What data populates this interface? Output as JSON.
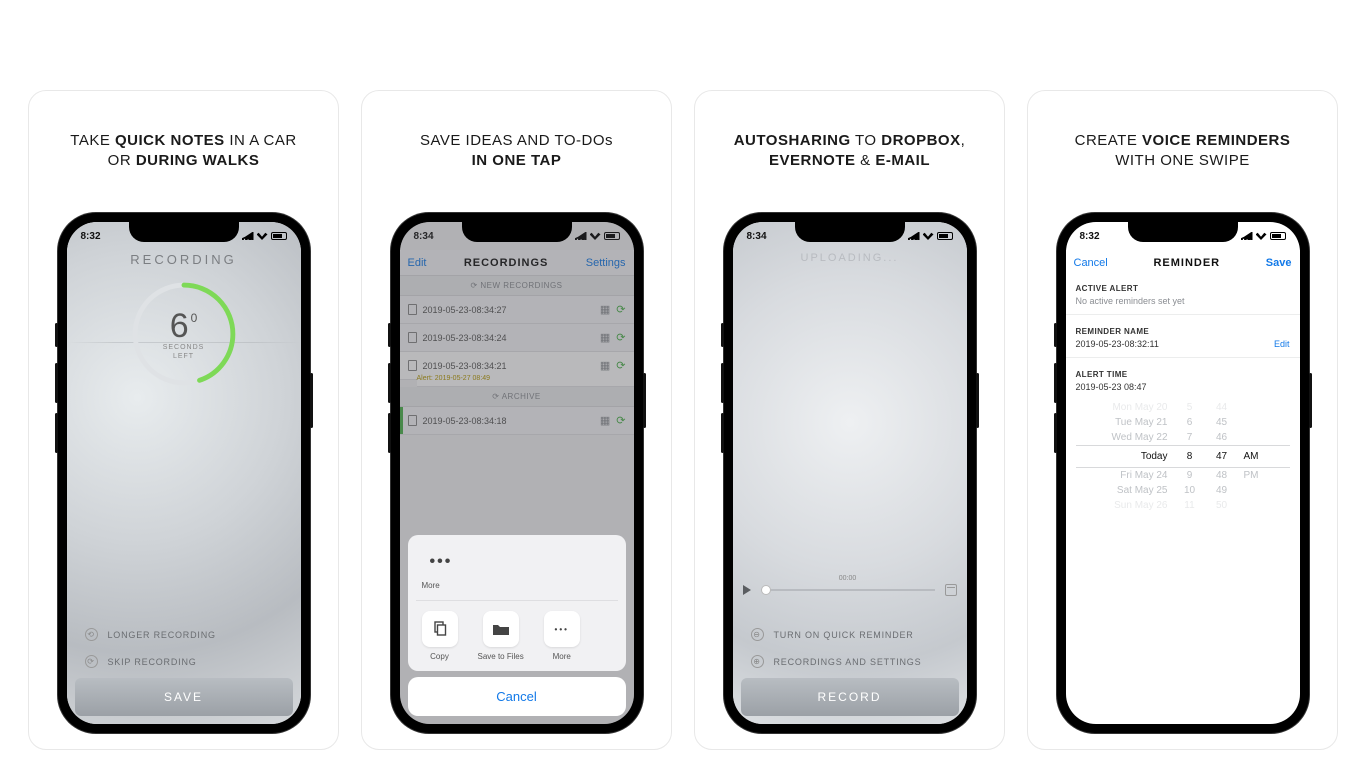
{
  "status_time": {
    "s1": "8:32",
    "s2": "8:34",
    "s3": "8:34",
    "s4": "8:32"
  },
  "captions": {
    "c1": {
      "pre": "TAKE ",
      "b1": "QUICK NOTES",
      "mid": " IN A CAR\nOR ",
      "b2": "DURING WALKS"
    },
    "c2": {
      "pre": "SAVE IDEAS AND TO-DOs\n",
      "b1": "IN ONE TAP"
    },
    "c3": {
      "b1": "AUTOSHARING",
      "mid1": " TO ",
      "b2": "DROPBOX",
      "mid2": ",\n",
      "b3": "EVERNOTE",
      "mid3": " & ",
      "b4": "E-MAIL"
    },
    "c4": {
      "pre": "CREATE ",
      "b1": "VOICE REMINDERS",
      "post": "\nWITH ONE SWIPE"
    }
  },
  "screen1": {
    "title": "RECORDING",
    "seconds": "6",
    "seconds_sup": "0",
    "seconds_label": "SECONDS\nLEFT",
    "longer": "LONGER RECORDING",
    "skip": "SKIP RECORDING",
    "save": "SAVE"
  },
  "screen2": {
    "nav_edit": "Edit",
    "nav_title": "RECORDINGS",
    "nav_settings": "Settings",
    "section_new": "⟳ NEW RECORDINGS",
    "section_archive": "⟳ ARCHIVE",
    "rows": [
      "2019-05-23-08:34:27",
      "2019-05-23-08:34:24",
      "2019-05-23-08:34:21"
    ],
    "row_alert": "Alert: 2019-05-27 08:49",
    "archive_row": "2019-05-23-08:34:18",
    "sheet": {
      "more_top": "More",
      "copy": "Copy",
      "save_files": "Save to Files",
      "more": "More",
      "cancel": "Cancel"
    }
  },
  "screen3": {
    "title": "UPLOADING...",
    "time": "00:00",
    "quick": "TURN ON QUICK REMINDER",
    "settings": "RECORDINGS AND SETTINGS",
    "record": "RECORD"
  },
  "screen4": {
    "nav_cancel": "Cancel",
    "nav_title": "REMINDER",
    "nav_save": "Save",
    "active_label": "ACTIVE ALERT",
    "active_sub": "No active reminders set yet",
    "name_label": "REMINDER NAME",
    "name_value": "2019-05-23-08:32:11",
    "edit": "Edit",
    "alert_label": "ALERT TIME",
    "alert_value": "2019-05-23 08:47",
    "picker": {
      "rows": [
        {
          "day": "Mon May 20",
          "h": "5",
          "m": "44",
          "a": ""
        },
        {
          "day": "Tue May 21",
          "h": "6",
          "m": "45",
          "a": ""
        },
        {
          "day": "Wed May 22",
          "h": "7",
          "m": "46",
          "a": ""
        },
        {
          "day": "Today",
          "h": "8",
          "m": "47",
          "a": "AM"
        },
        {
          "day": "Fri May 24",
          "h": "9",
          "m": "48",
          "a": "PM"
        },
        {
          "day": "Sat May 25",
          "h": "10",
          "m": "49",
          "a": ""
        },
        {
          "day": "Sun May 26",
          "h": "11",
          "m": "50",
          "a": ""
        }
      ],
      "selected_index": 3
    }
  }
}
